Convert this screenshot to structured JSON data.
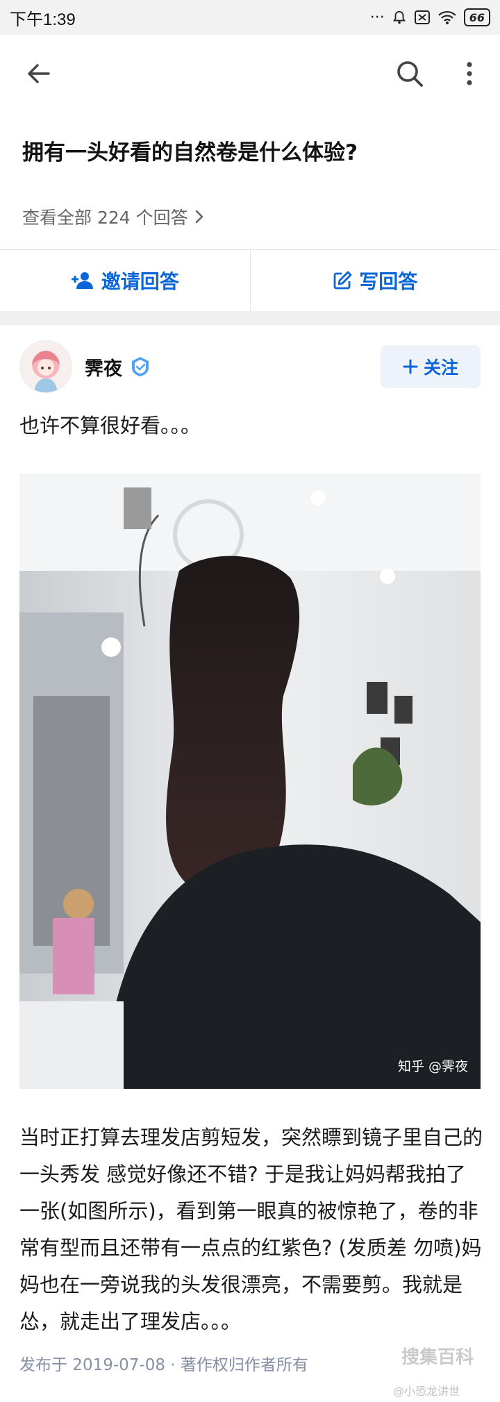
{
  "status_bar": {
    "time": "下午1:39",
    "dots": "···",
    "battery": "66"
  },
  "question": {
    "title": "拥有一头好看的自然卷是什么体验?",
    "view_all": "查看全部 224 个回答"
  },
  "actions": {
    "invite": "邀请回答",
    "write": "写回答"
  },
  "author": {
    "name": "霁夜",
    "follow": "关注"
  },
  "answer": {
    "intro": "也许不算很好看。。。",
    "photo_watermark": "知乎 @霁夜",
    "body": "当时正打算去理发店剪短发，突然瞟到镜子里自己的一头秀发 感觉好像还不错? 于是我让妈妈帮我拍了一张(如图所示)，看到第一眼真的被惊艳了，卷的非常有型而且还带有一点点的红紫色? (发质差 勿喷)妈妈也在一旁说我的头发很漂亮，不需要剪。我就是怂，就走出了理发店。。。",
    "publish_info": "发布于 2019-07-08 · 著作权归作者所有"
  },
  "watermark": {
    "corner_logo": "搜集百科",
    "corner_weibo": "@小恐龙讲世"
  },
  "colors": {
    "accent": "#0a66d8",
    "muted": "#8590a6"
  }
}
